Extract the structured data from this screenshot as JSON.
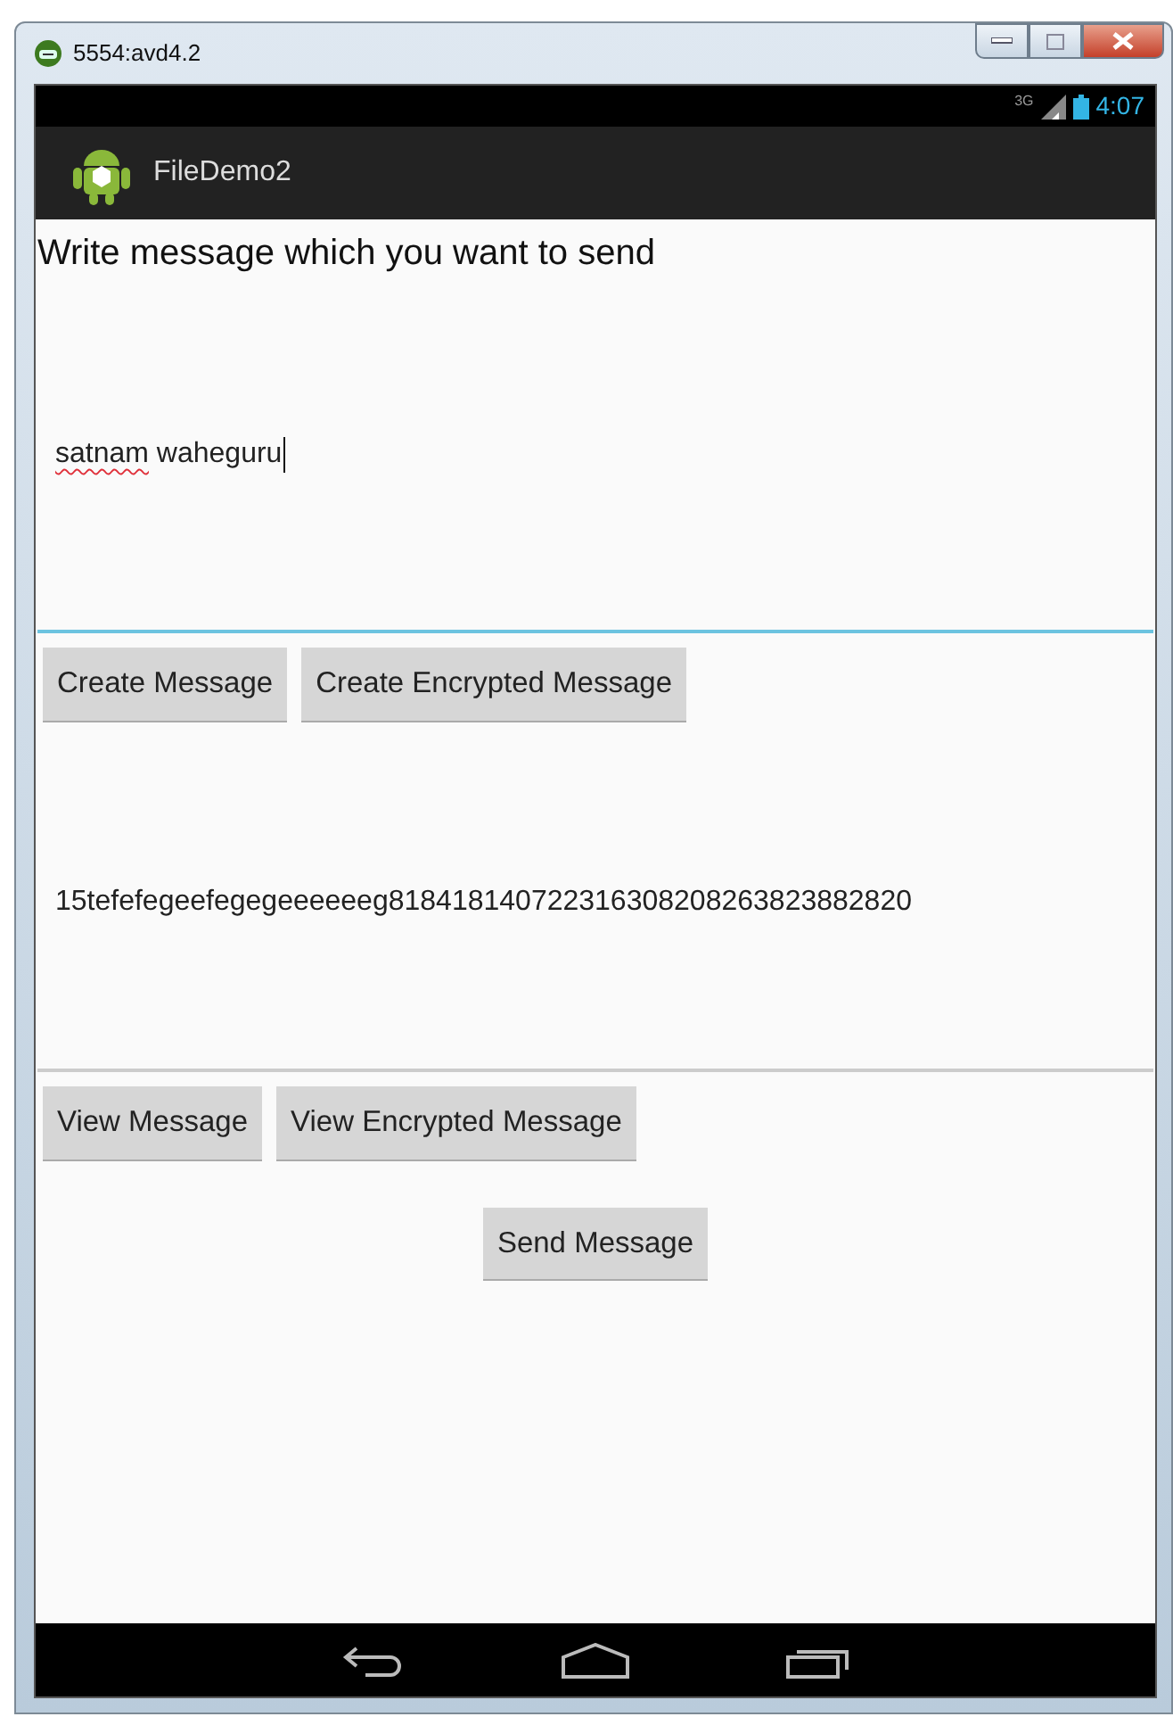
{
  "window": {
    "title": "5554:avd4.2"
  },
  "status_bar": {
    "network": "3G",
    "time": "4:07"
  },
  "action_bar": {
    "title": "FileDemo2"
  },
  "prompt": "Write message which you want to send",
  "message_field": {
    "focused": true,
    "parts": [
      {
        "text": "satnam",
        "misspelled": true
      },
      {
        "text": " waheguru",
        "misspelled": false
      }
    ]
  },
  "create_buttons": [
    "Create Message",
    "Create Encrypted Message"
  ],
  "encrypted_field": {
    "focused": false,
    "parts": [
      {
        "text": "15tefefegeefegegeeeeeeg818418140722316308208263823882820",
        "misspelled": false
      }
    ]
  },
  "view_buttons": [
    "View Message",
    "View Encrypted Message"
  ],
  "send_button": "Send Message"
}
